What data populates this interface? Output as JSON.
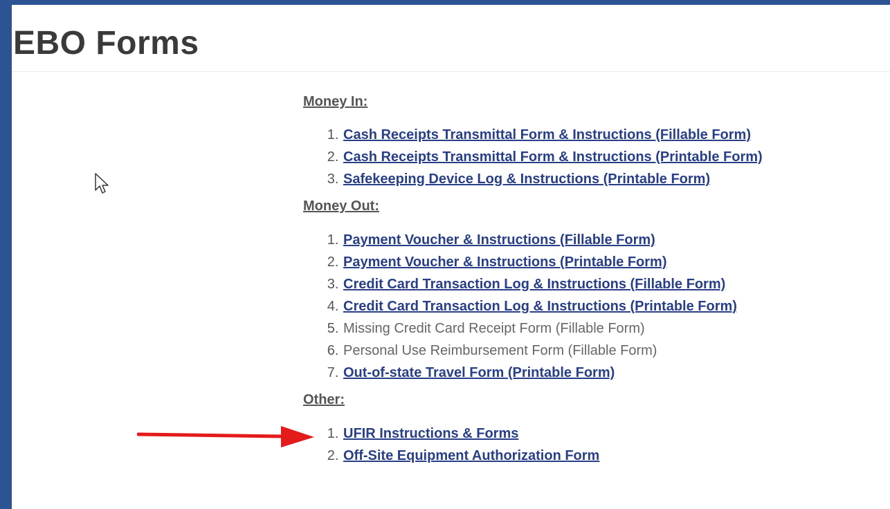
{
  "page": {
    "title": "EBO Forms"
  },
  "sections": [
    {
      "heading": "Money In:",
      "items": [
        {
          "num": 1,
          "label": "Cash Receipts Transmittal Form & Instructions (Fillable Form)",
          "link": true
        },
        {
          "num": 2,
          "label": "Cash Receipts Transmittal Form & Instructions (Printable Form)",
          "link": true
        },
        {
          "num": 3,
          "label": "Safekeeping Device Log & Instructions (Printable Form)",
          "link": true
        }
      ]
    },
    {
      "heading": "Money Out:",
      "items": [
        {
          "num": 1,
          "label": "Payment Voucher & Instructions (Fillable Form)",
          "link": true
        },
        {
          "num": 2,
          "label": "Payment Voucher & Instructions (Printable Form)",
          "link": true
        },
        {
          "num": 3,
          "label": "Credit Card Transaction Log & Instructions (Fillable Form)",
          "link": true
        },
        {
          "num": 4,
          "label": "Credit Card Transaction Log & Instructions (Printable Form)",
          "link": true
        },
        {
          "num": 5,
          "label": "Missing Credit Card Receipt Form (Fillable Form)",
          "link": false
        },
        {
          "num": 6,
          "label": "Personal Use Reimbursement Form (Fillable Form)",
          "link": false
        },
        {
          "num": 7,
          "label": "Out-of-state Travel Form (Printable Form)",
          "link": true
        }
      ]
    },
    {
      "heading": "Other:",
      "items": [
        {
          "num": 1,
          "label": "UFIR Instructions & Forms",
          "link": true
        },
        {
          "num": 2,
          "label": "Off-Site Equipment Authorization Form",
          "link": true
        }
      ]
    }
  ],
  "colors": {
    "frame": "#2c5394",
    "link": "#283f87",
    "text": "#555555",
    "arrow": "#e31b1b"
  },
  "icons": {
    "cursor": "mouse-pointer-icon",
    "annotation": "red-arrow-icon"
  }
}
